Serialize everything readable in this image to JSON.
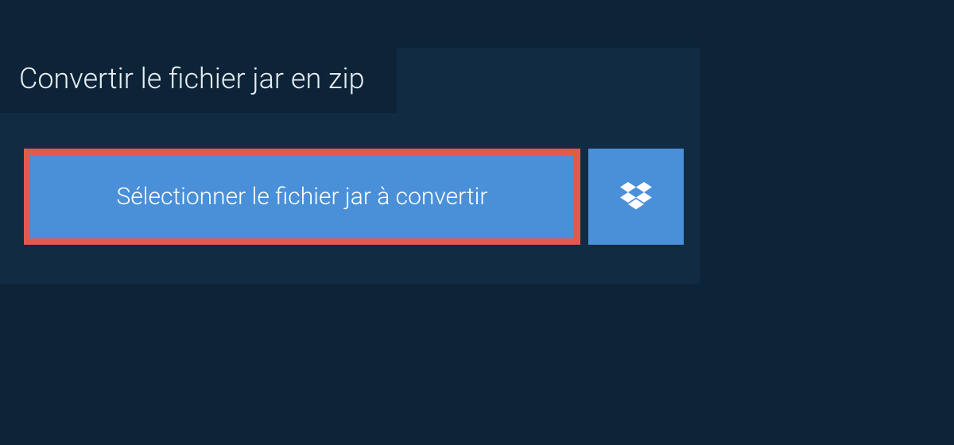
{
  "header": {
    "title": "Convertir le fichier jar en zip"
  },
  "upload": {
    "select_label": "Sélectionner le fichier jar à convertir"
  },
  "colors": {
    "page_bg": "#0d2438",
    "panel_bg": "#112b42",
    "button_bg": "#4a90d9",
    "highlight_border": "#e25a4f",
    "text": "#ffffff"
  }
}
